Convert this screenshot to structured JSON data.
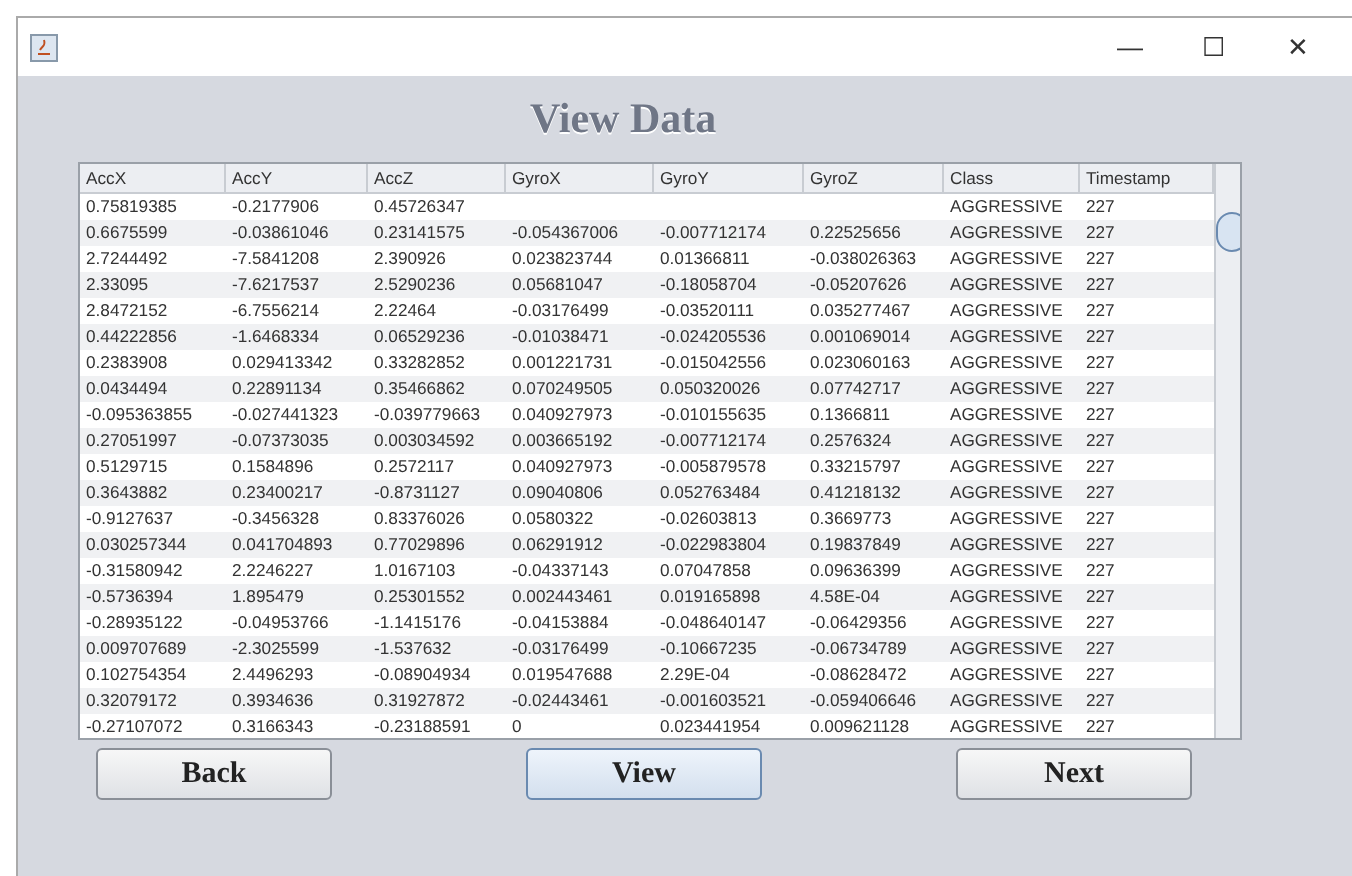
{
  "window": {
    "title_bar_buttons": [
      "—",
      "☐",
      "✕"
    ]
  },
  "heading": "View Data",
  "table": {
    "columns": [
      "AccX",
      "AccY",
      "AccZ",
      "GyroX",
      "GyroY",
      "GyroZ",
      "Class",
      "Timestamp"
    ],
    "rows": [
      [
        "0.75819385",
        "-0.2177906",
        "0.45726347",
        null,
        null,
        null,
        "AGGRESSIVE",
        "227"
      ],
      [
        "0.6675599",
        "-0.03861046",
        "0.23141575",
        "-0.054367006",
        "-0.007712174",
        "0.22525656",
        "AGGRESSIVE",
        "227"
      ],
      [
        "2.7244492",
        "-7.5841208",
        "2.390926",
        "0.023823744",
        "0.01366811",
        "-0.038026363",
        "AGGRESSIVE",
        "227"
      ],
      [
        "2.33095",
        "-7.6217537",
        "2.5290236",
        "0.05681047",
        "-0.18058704",
        "-0.05207626",
        "AGGRESSIVE",
        "227"
      ],
      [
        "2.8472152",
        "-6.7556214",
        "2.22464",
        "-0.03176499",
        "-0.03520111",
        "0.035277467",
        "AGGRESSIVE",
        "227"
      ],
      [
        "0.44222856",
        "-1.6468334",
        "0.06529236",
        "-0.01038471",
        "-0.024205536",
        "0.001069014",
        "AGGRESSIVE",
        "227"
      ],
      [
        "0.2383908",
        "0.029413342",
        "0.33282852",
        "0.001221731",
        "-0.015042556",
        "0.023060163",
        "AGGRESSIVE",
        "227"
      ],
      [
        "0.0434494",
        "0.22891134",
        "0.35466862",
        "0.070249505",
        "0.050320026",
        "0.07742717",
        "AGGRESSIVE",
        "227"
      ],
      [
        "-0.095363855",
        "-0.027441323",
        "-0.039779663",
        "0.040927973",
        "-0.010155635",
        "0.1366811",
        "AGGRESSIVE",
        "227"
      ],
      [
        "0.27051997",
        "-0.07373035",
        "0.003034592",
        "0.003665192",
        "-0.007712174",
        "0.2576324",
        "AGGRESSIVE",
        "227"
      ],
      [
        "0.5129715",
        "0.1584896",
        "0.2572117",
        "0.040927973",
        "-0.005879578",
        "0.33215797",
        "AGGRESSIVE",
        "227"
      ],
      [
        "0.3643882",
        "0.23400217",
        "-0.8731127",
        "0.09040806",
        "0.052763484",
        "0.41218132",
        "AGGRESSIVE",
        "227"
      ],
      [
        "-0.9127637",
        "-0.3456328",
        "0.83376026",
        "0.0580322",
        "-0.02603813",
        "0.3669773",
        "AGGRESSIVE",
        "227"
      ],
      [
        "0.030257344",
        "0.041704893",
        "0.77029896",
        "0.06291912",
        "-0.022983804",
        "0.19837849",
        "AGGRESSIVE",
        "227"
      ],
      [
        "-0.31580942",
        "2.2246227",
        "1.0167103",
        "-0.04337143",
        "0.07047858",
        "0.09636399",
        "AGGRESSIVE",
        "227"
      ],
      [
        "-0.5736394",
        "1.895479",
        "0.25301552",
        "0.002443461",
        "0.019165898",
        "4.58E-04",
        "AGGRESSIVE",
        "227"
      ],
      [
        "-0.28935122",
        "-0.04953766",
        "-1.1415176",
        "-0.04153884",
        "-0.048640147",
        "-0.06429356",
        "AGGRESSIVE",
        "227"
      ],
      [
        "0.009707689",
        "-2.3025599",
        "-1.537632",
        "-0.03176499",
        "-0.10667235",
        "-0.06734789",
        "AGGRESSIVE",
        "227"
      ],
      [
        "0.102754354",
        "2.4496293",
        "-0.08904934",
        "0.019547688",
        "2.29E-04",
        "-0.08628472",
        "AGGRESSIVE",
        "227"
      ],
      [
        "0.32079172",
        "0.3934636",
        "0.31927872",
        "-0.02443461",
        "-0.001603521",
        "-0.059406646",
        "AGGRESSIVE",
        "227"
      ],
      [
        "-0.27107072",
        "0.3166343",
        "-0.23188591",
        "0",
        "0.023441954",
        "0.009621128",
        "AGGRESSIVE",
        "227"
      ]
    ]
  },
  "buttons": [
    {
      "label": "Back",
      "selected": false
    },
    {
      "label": "View",
      "selected": true
    },
    {
      "label": "Next",
      "selected": false
    }
  ]
}
